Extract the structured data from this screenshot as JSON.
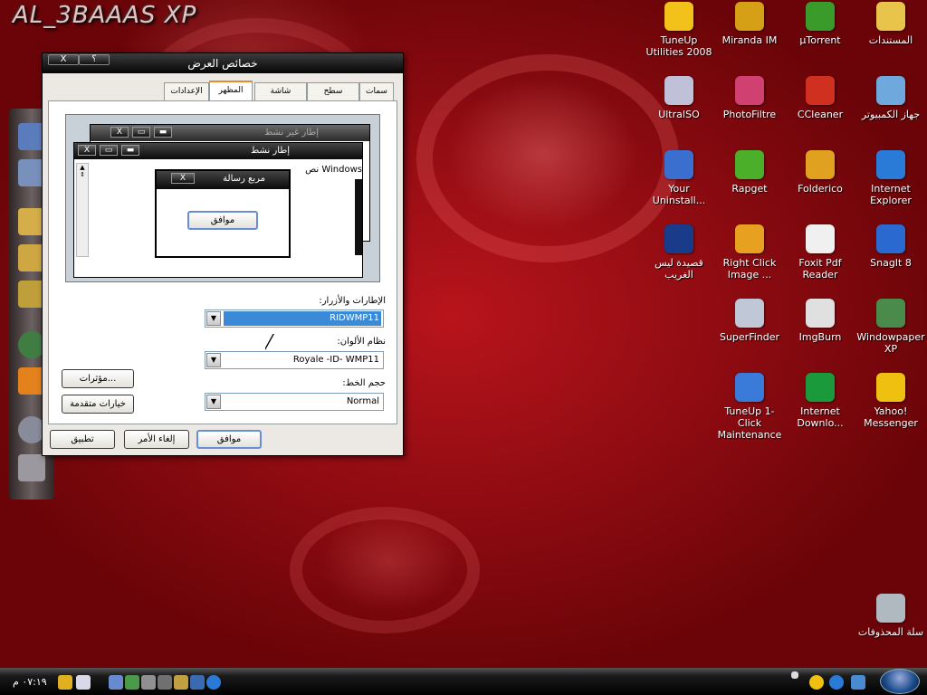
{
  "brand": "AL_3BAAAS XP",
  "desktop_icons": [
    {
      "label": "TuneUp Utilities 2008",
      "icon": "tuneup-icon",
      "color": "#f2c21a"
    },
    {
      "label": "Miranda IM",
      "icon": "miranda-icon",
      "color": "#d6a016"
    },
    {
      "label": "µTorrent",
      "icon": "utorrent-icon",
      "color": "#3a9a2a"
    },
    {
      "label": "المستندات",
      "icon": "documents-folder-icon",
      "color": "#e8c44a"
    },
    {
      "label": "UltraISO",
      "icon": "ultraiso-icon",
      "color": "#c0c0d8"
    },
    {
      "label": "PhotoFiltre",
      "icon": "photofiltre-icon",
      "color": "#d04070"
    },
    {
      "label": "CCleaner",
      "icon": "ccleaner-icon",
      "color": "#d03020"
    },
    {
      "label": "جهاز الكمبيوتر",
      "icon": "my-computer-icon",
      "color": "#6fa8dc"
    },
    {
      "label": "Your Uninstall...",
      "icon": "your-uninstaller-icon",
      "color": "#3a6fd0"
    },
    {
      "label": "Rapget",
      "icon": "rapget-icon",
      "color": "#4caf2a"
    },
    {
      "label": "Folderico",
      "icon": "folderico-icon",
      "color": "#e0a020"
    },
    {
      "label": "Internet Explorer",
      "icon": "internet-explorer-icon",
      "color": "#2a7ad8"
    },
    {
      "label": "قصيدة ليس الغريب",
      "icon": "realplayer-icon",
      "color": "#1a3a8a"
    },
    {
      "label": "Right Click Image ...",
      "icon": "right-click-image-icon",
      "color": "#e8a020"
    },
    {
      "label": "Foxit Pdf Reader",
      "icon": "foxit-reader-icon",
      "color": "#f0f0f0"
    },
    {
      "label": "SnagIt 8",
      "icon": "snagit-icon",
      "color": "#2a6ad0"
    },
    {
      "label": "SuperFinder",
      "icon": "superfinder-icon",
      "color": "#c0c8d8"
    },
    {
      "label": "ImgBurn",
      "icon": "imgburn-icon",
      "color": "#e0e0e0"
    },
    {
      "label": "Windowpaper XP",
      "icon": "windowpaper-icon",
      "color": "#4a8a4a"
    },
    {
      "label": "TuneUp 1-Click Maintenance",
      "icon": "tuneup-1click-icon",
      "color": "#3a7ad8"
    },
    {
      "label": "Internet Downlo...",
      "icon": "internet-download-manager-icon",
      "color": "#1a9a3a"
    },
    {
      "label": "Yahoo! Messenger",
      "icon": "yahoo-messenger-icon",
      "color": "#f0c010"
    },
    {
      "label": "سلة المحذوفات",
      "icon": "recycle-bin-icon",
      "color": "#b0b8c0"
    }
  ],
  "dialog": {
    "title": "خصائص العرض",
    "help_glyph": "؟",
    "close_glyph": "X",
    "tabs": [
      "سمات",
      "سطح المكتب",
      "شاشة التوقف",
      "المظهر",
      "الإعدادات"
    ],
    "active_tab": "المظهر",
    "preview": {
      "inactive_window_title": "إطار غير نشط",
      "active_window_title": "إطار نشط",
      "window_text": "نص Windows",
      "message_box_title": "مربع رسالة",
      "message_box_ok": "موافق",
      "close_glyph": "X"
    },
    "fields": {
      "windows_buttons_label": "الإطارات والأزرار:",
      "windows_buttons_value": "RIDWMP11",
      "color_scheme_label": "نظام الألوان:",
      "color_scheme_value": "Royale -ID- WMP11",
      "font_size_label": "حجم الخط:",
      "font_size_value": "Normal"
    },
    "effects_button": "مؤثرات...",
    "advanced_button": "خيارات متقدمة",
    "ok_button": "موافق",
    "cancel_button": "إلغاء الأمر",
    "apply_button": "تطبيق"
  },
  "taskbar": {
    "clock": "٠٧:١٩ م"
  },
  "colors": {
    "desktop_red": "#9a0c14",
    "selection_blue": "#3a8ad8",
    "default_button_border": "#6a8ed6",
    "active_tab_accent": "#e68b2c"
  }
}
